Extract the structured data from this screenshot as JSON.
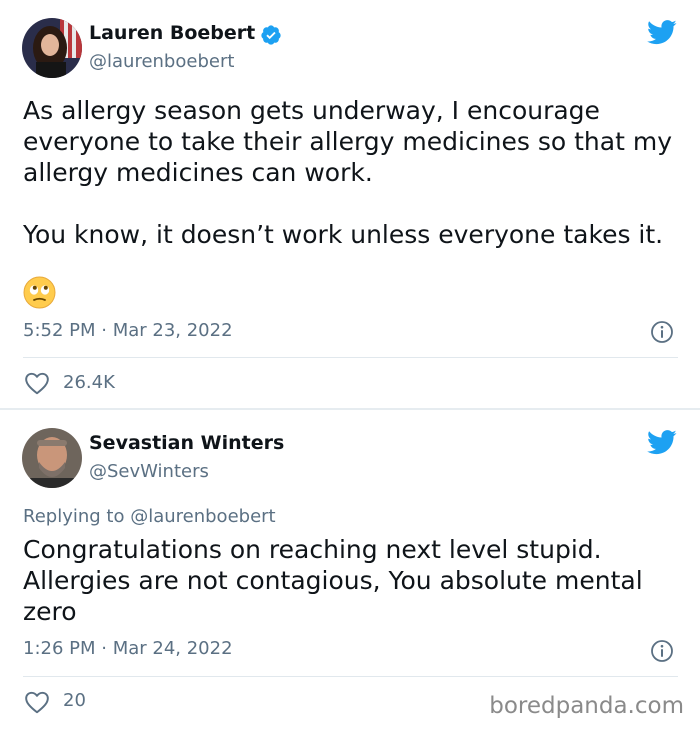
{
  "tweets": [
    {
      "author_name": "Lauren Boebert",
      "verified": true,
      "handle": "@laurenboebert",
      "text_paragraph_1": "As allergy season gets underway, I encourage everyone to take their allergy medicines so that my allergy medicines can work.",
      "text_paragraph_2": "You know, it doesn’t work unless everyone takes it.",
      "emoji": "face-with-rolling-eyes",
      "timestamp": "5:52 PM · Mar 23, 2022",
      "likes": "26.4K"
    },
    {
      "author_name": "Sevastian Winters",
      "verified": false,
      "handle": "@SevWinters",
      "replying_to": "Replying to @laurenboebert",
      "text": "Congratulations on reaching next level stupid. Allergies are not contagious, You absolute mental zero",
      "timestamp": "1:26 PM · Mar 24, 2022",
      "likes": "20"
    }
  ],
  "watermark": "boredpanda.com",
  "colors": {
    "twitter_blue": "#1da1f2",
    "secondary_text": "#5b7083",
    "primary_text": "#0f1419",
    "divider": "#e1e8ed"
  },
  "icons": {
    "brand": "twitter-bird-icon",
    "verified": "verified-badge-icon",
    "info": "info-icon",
    "like": "heart-icon"
  }
}
